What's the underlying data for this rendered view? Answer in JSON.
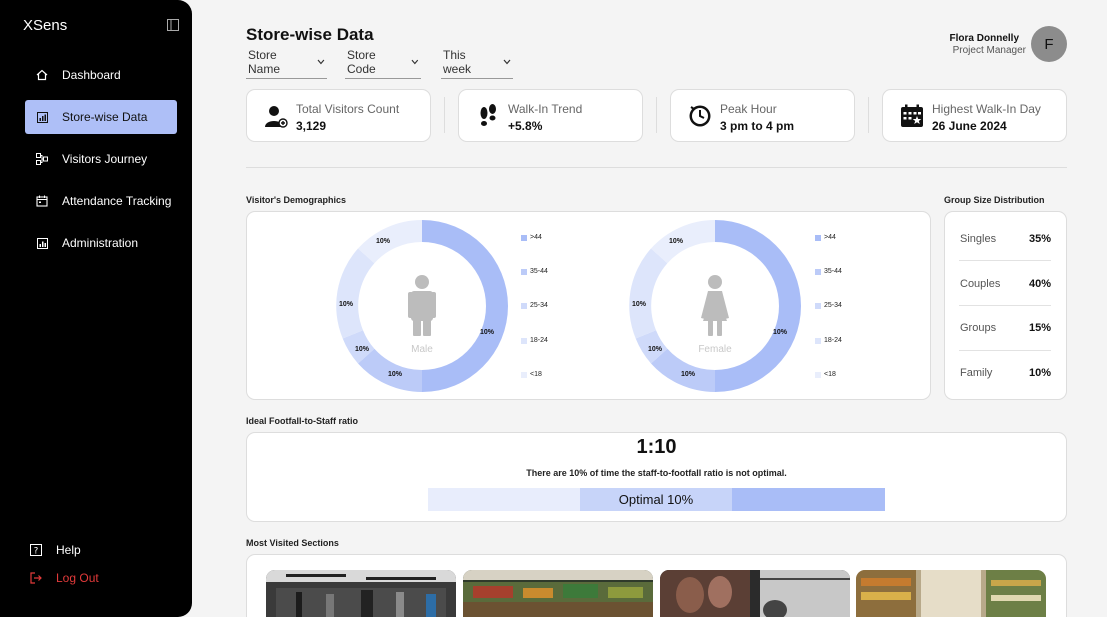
{
  "app": {
    "brand": "XSens"
  },
  "sidebar": {
    "items": [
      {
        "label": "Dashboard",
        "icon": "home-icon"
      },
      {
        "label": "Store-wise Data",
        "icon": "bar-chart-icon",
        "active": true
      },
      {
        "label": "Visitors Journey",
        "icon": "journey-icon"
      },
      {
        "label": "Attendance Tracking",
        "icon": "calendar-icon"
      },
      {
        "label": "Administration",
        "icon": "admin-chart-icon"
      }
    ],
    "help": "Help",
    "logout": "Log Out"
  },
  "header": {
    "title": "Store-wise Data",
    "filters": {
      "store_name": "Store Name",
      "store_code": "Store Code",
      "period": "This week"
    },
    "user": {
      "name": "Flora Donnelly",
      "role": "Project Manager",
      "initial": "F"
    }
  },
  "kpis": [
    {
      "label": "Total Visitors Count",
      "value": "3,129",
      "icon": "visitor-icon"
    },
    {
      "label": "Walk-In Trend",
      "value": "+5.8%",
      "icon": "footprints-icon"
    },
    {
      "label": "Peak Hour",
      "value": "3 pm to 4 pm",
      "icon": "clock-icon"
    },
    {
      "label": "Highest Walk-In Day",
      "value": "26 June 2024",
      "icon": "calendar-star-icon"
    }
  ],
  "demographics": {
    "title": "Visitor's Demographics",
    "legend": [
      ">44",
      "35-44",
      "25-34",
      "18-24",
      "<18"
    ],
    "colors": [
      "#a9bdf7",
      "#bccbf8",
      "#cfdafa",
      "#dde5fb",
      "#e9eefc"
    ],
    "male": {
      "caption": "Male",
      "labels": [
        "10%",
        "10%",
        "10%",
        "10%",
        "10%"
      ]
    },
    "female": {
      "caption": "Female",
      "labels": [
        "10%",
        "10%",
        "10%",
        "10%",
        "10%"
      ]
    }
  },
  "group_size": {
    "title": "Group Size Distribution",
    "rows": [
      {
        "label": "Singles",
        "value": "35%"
      },
      {
        "label": "Couples",
        "value": "40%"
      },
      {
        "label": "Groups",
        "value": "15%"
      },
      {
        "label": "Family",
        "value": "10%"
      }
    ]
  },
  "footfall": {
    "title": "Ideal Footfall-to-Staff ratio",
    "ratio": "1:10",
    "note": "There are 10% of time the staff-to-footfall ratio is not optimal.",
    "bar_label": "Optimal 10%"
  },
  "sections": {
    "title": "Most Visited Sections"
  }
}
